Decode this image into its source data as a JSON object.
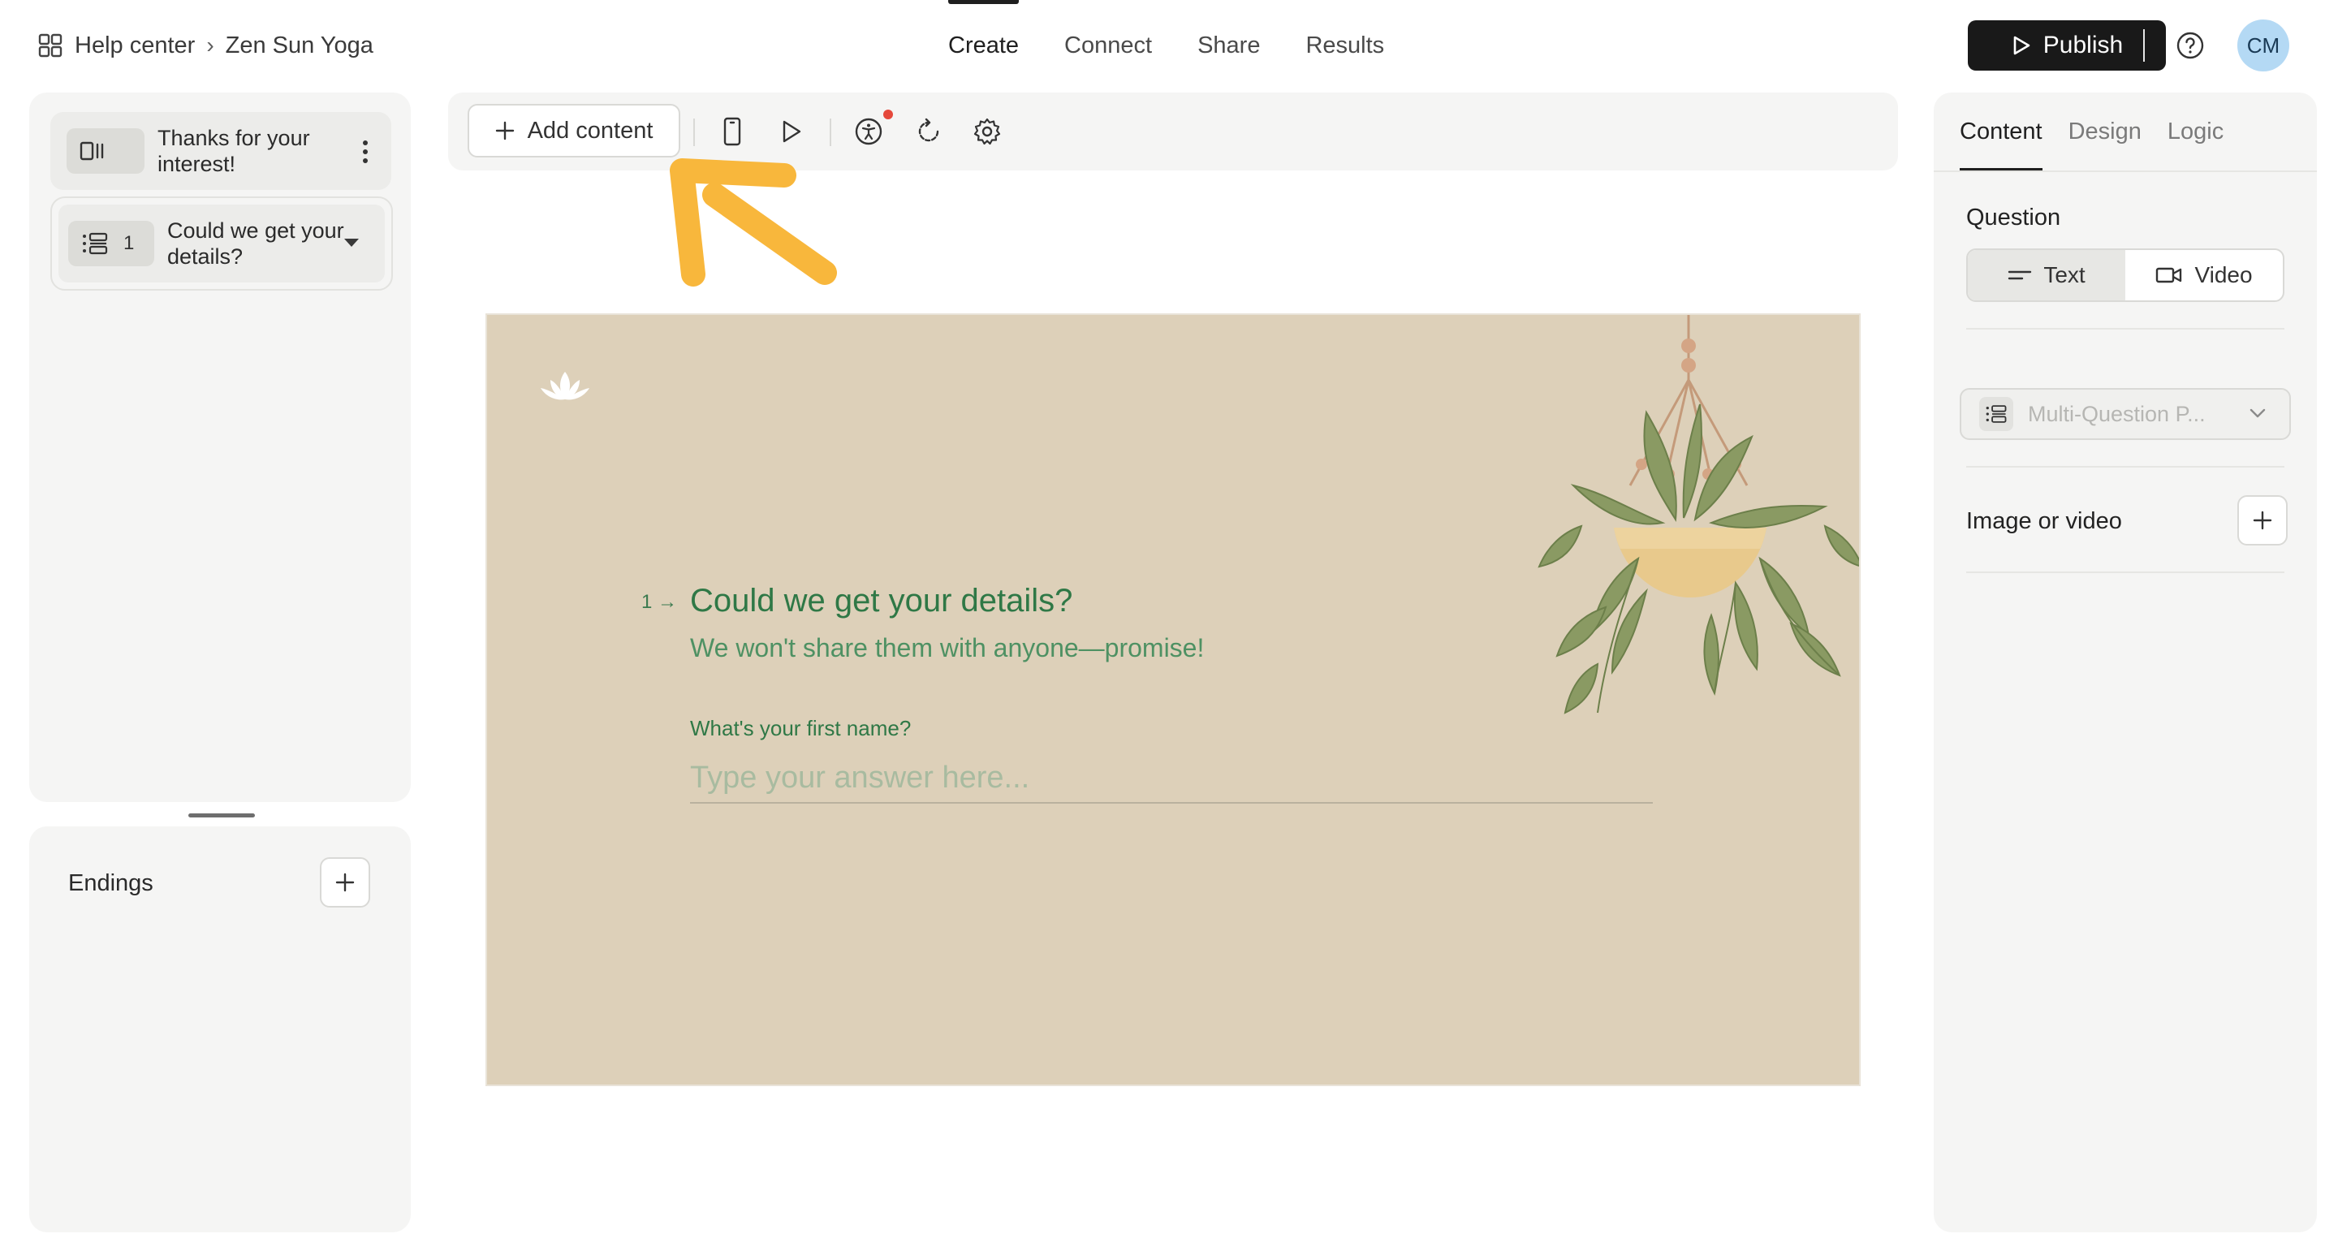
{
  "breadcrumb": {
    "root": "Help center",
    "current": "Zen Sun Yoga"
  },
  "nav": {
    "tabs": [
      {
        "label": "Create"
      },
      {
        "label": "Connect"
      },
      {
        "label": "Share"
      },
      {
        "label": "Results"
      }
    ]
  },
  "header": {
    "publish_label": "Publish",
    "avatar_initials": "CM"
  },
  "left_panel": {
    "items": [
      {
        "text": "Thanks for your interest!"
      },
      {
        "number": "1",
        "text": "Could we get your details?"
      }
    ],
    "endings_label": "Endings"
  },
  "toolbar": {
    "add_content_label": "Add content"
  },
  "form": {
    "question_number": "1",
    "question_title": "Could we get your details?",
    "question_subtitle": "We won't share them with anyone—promise!",
    "field_label": "What's your first name?",
    "field_placeholder": "Type your answer here..."
  },
  "right_panel": {
    "tabs": [
      {
        "label": "Content"
      },
      {
        "label": "Design"
      },
      {
        "label": "Logic"
      }
    ],
    "question_label": "Question",
    "segment": {
      "text_label": "Text",
      "video_label": "Video"
    },
    "type_select_value": "Multi-Question P...",
    "image_label": "Image or video"
  },
  "colors": {
    "publish_bg": "#191919",
    "avatar_bg": "#b4d9f4",
    "canvas_bg": "#ddd0b9",
    "question_green": "#2f7846",
    "annotation_arrow": "#f8b73c",
    "notification_dot": "#e5483b"
  }
}
